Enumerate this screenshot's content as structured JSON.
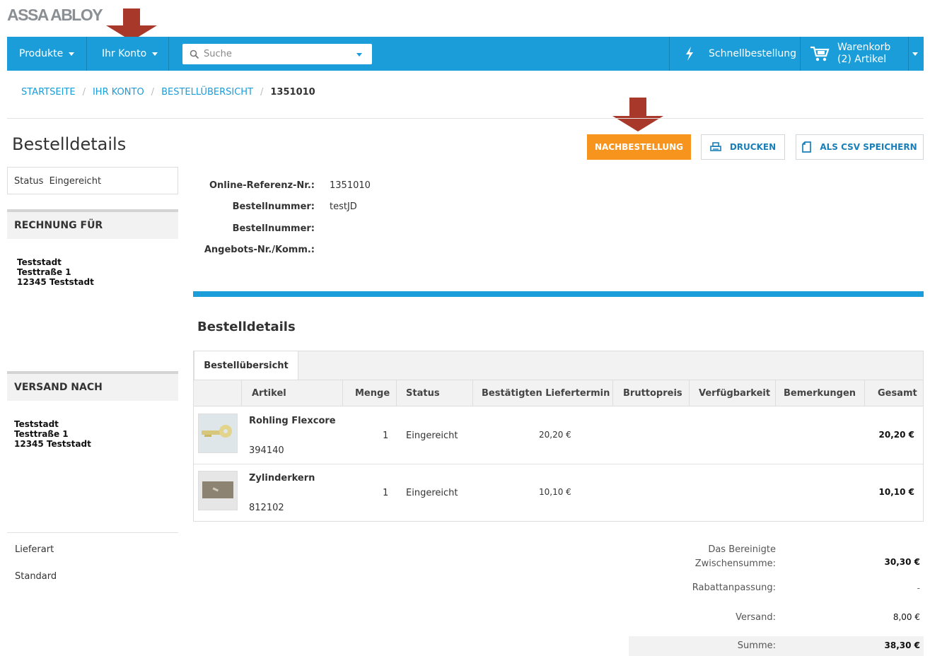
{
  "brand": {
    "logo_text": "ASSA ABLOY"
  },
  "nav": {
    "products_label": "Produkte",
    "account_label": "Ihr Konto",
    "search_placeholder": "Suche",
    "quick_order_label": "Schnellbestellung",
    "cart_title": "Warenkorb",
    "cart_count": "(2) Artikel"
  },
  "breadcrumb": {
    "items": [
      "STARTSEITE",
      "IHR KONTO",
      "BESTELLÜBERSICHT"
    ],
    "current": "1351010"
  },
  "page": {
    "title": "Bestelldetails"
  },
  "actions": {
    "reorder_label": "NACHBESTELLUNG",
    "print_label": "DRUCKEN",
    "csv_label": "ALS CSV SPEICHERN"
  },
  "sidebar": {
    "status_label": "Status",
    "status_value": "Eingereicht",
    "billing_title": "RECHNUNG FÜR",
    "billing_address": [
      "Teststadt",
      "Testtraße 1",
      "12345 Teststadt"
    ],
    "shipping_title": "VERSAND NACH",
    "shipping_address": [
      "Teststadt",
      "Testtraße 1",
      "12345 Teststadt"
    ],
    "delivery_label": "Lieferart",
    "delivery_value": "Standard"
  },
  "order_info": {
    "online_ref_label": "Online-Referenz-Nr.:",
    "online_ref_value": "1351010",
    "order_number_label": "Bestellnummer:",
    "order_number_value": "testJD",
    "order_number2_label": "Bestellnummer:",
    "offer_label": "Angebots-Nr./Komm.:"
  },
  "details": {
    "title": "Bestelldetails",
    "tab_label": "Bestellübersicht",
    "columns": [
      "Artikel",
      "Menge",
      "Status",
      "Bestätigten Liefertermin",
      "Bruttopreis",
      "Verfügbarkeit",
      "Bemerkungen",
      "Gesamt"
    ],
    "rows": [
      {
        "name": "Rohling Flexcore",
        "sku": "394140",
        "qty": "1",
        "status": "Eingereicht",
        "price": "20,20 €",
        "total": "20,20 €",
        "image": "key-blank"
      },
      {
        "name": "Zylinderkern",
        "sku": "812102",
        "qty": "1",
        "status": "Eingereicht",
        "price": "10,10 €",
        "total": "10,10 €",
        "image": "cylinder-core"
      }
    ]
  },
  "summary": {
    "subtotal_label_1": "Das Bereinigte",
    "subtotal_label_2": "Zwischensumme:",
    "subtotal_value": "30,30 €",
    "discount_label": "Rabattanpassung:",
    "discount_value": "-",
    "shipping_label": "Versand:",
    "shipping_value": "8,00 €",
    "total_label": "Summe:",
    "total_value": "38,30 €"
  },
  "colors": {
    "primary": "#1a9dd8",
    "accent": "#f7941d",
    "arrow": "#a8392a"
  }
}
